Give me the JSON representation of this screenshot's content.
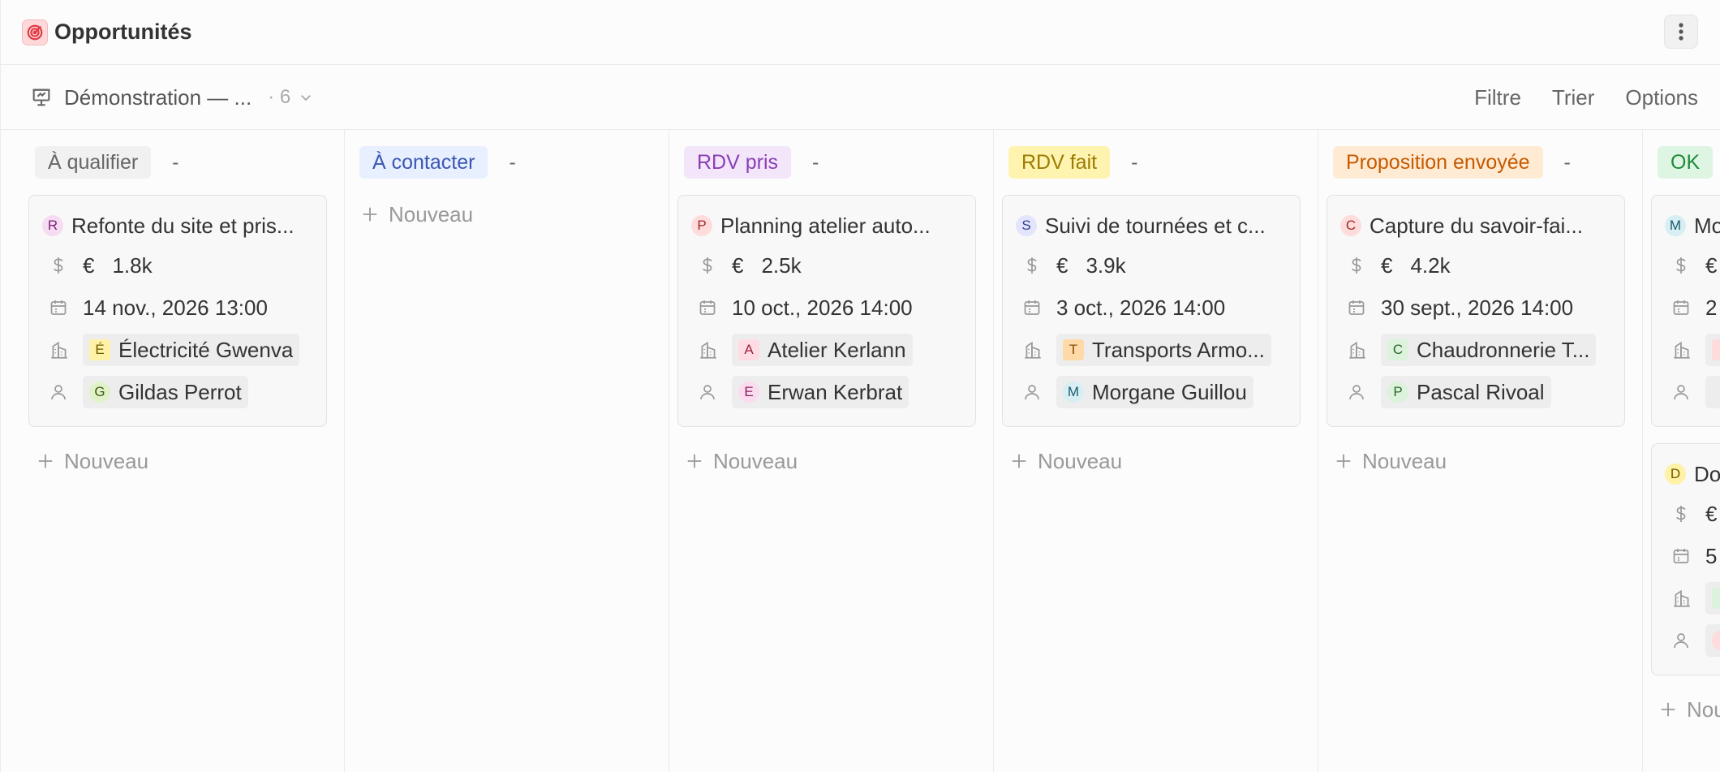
{
  "header": {
    "title": "Opportunités"
  },
  "view": {
    "name": "Démonstration — ...",
    "count": "· 6",
    "actions": {
      "filter": "Filtre",
      "sort": "Trier",
      "options": "Options"
    }
  },
  "new_label": "Nouveau",
  "columns": [
    {
      "label": "À qualifier",
      "dash": "-",
      "bg": "#f1f1f1",
      "fg": "#666666",
      "cards": [
        {
          "initial": "R",
          "avatar_bg": "#f6dcf3",
          "avatar_fg": "#7a1f72",
          "title": "Refonte du site et pris...",
          "currency": "€",
          "amount": "1.8k",
          "date": "14 nov., 2026 13:00",
          "company_initial": "É",
          "company_bg": "#fff1a6",
          "company_fg": "#6b5a00",
          "company": "Électricité Gwenva",
          "person_initial": "G",
          "person_bg": "#e1f2c8",
          "person_fg": "#3d5a14",
          "person": "Gildas Perrot"
        }
      ]
    },
    {
      "label": "À contacter",
      "dash": "-",
      "bg": "#e8efff",
      "fg": "#3c57b3",
      "cards": []
    },
    {
      "label": "RDV pris",
      "dash": "-",
      "bg": "#f3e6fb",
      "fg": "#8a3fb5",
      "cards": [
        {
          "initial": "P",
          "avatar_bg": "#ffdcdc",
          "avatar_fg": "#a22a2a",
          "title": "Planning atelier auto...",
          "currency": "€",
          "amount": "2.5k",
          "date": "10 oct., 2026 14:00",
          "company_initial": "A",
          "company_bg": "#ffdce3",
          "company_fg": "#9c2342",
          "company": "Atelier Kerlann",
          "person_initial": "E",
          "person_bg": "#fbdcef",
          "person_fg": "#8b1d63",
          "person": "Erwan Kerbrat"
        }
      ]
    },
    {
      "label": "RDV fait",
      "dash": "-",
      "bg": "#fff3b0",
      "fg": "#9a7d00",
      "cards": [
        {
          "initial": "S",
          "avatar_bg": "#e2e5fb",
          "avatar_fg": "#33408f",
          "title": "Suivi de tournées et c...",
          "currency": "€",
          "amount": "3.9k",
          "date": "3 oct., 2026 14:00",
          "company_initial": "T",
          "company_bg": "#ffd9a8",
          "company_fg": "#8a4a00",
          "company": "Transports Armo...",
          "person_initial": "M",
          "person_bg": "#d7eef3",
          "person_fg": "#1d5a6a",
          "person": "Morgane Guillou"
        }
      ]
    },
    {
      "label": "Proposition envoyée",
      "dash": "-",
      "bg": "#ffebd3",
      "fg": "#c75a00",
      "cards": [
        {
          "initial": "C",
          "avatar_bg": "#ffdcdc",
          "avatar_fg": "#a22a2a",
          "title": "Capture du savoir-fai...",
          "currency": "€",
          "amount": "4.2k",
          "date": "30 sept., 2026 14:00",
          "company_initial": "C",
          "company_bg": "#dcf2dc",
          "company_fg": "#2a6a2a",
          "company": "Chaudronnerie T...",
          "person_initial": "P",
          "person_bg": "#dcf2dc",
          "person_fg": "#2a6a2a",
          "person": "Pascal Rivoal"
        }
      ]
    },
    {
      "label": "OK",
      "dash": "",
      "bg": "#def5e3",
      "fg": "#1f8a3a",
      "cards": [
        {
          "initial": "M",
          "avatar_bg": "#d7eef3",
          "avatar_fg": "#1d5a6a",
          "title": "Mo",
          "currency": "€",
          "amount": "",
          "date": "2",
          "company_initial": "",
          "company_bg": "#ffdcdc",
          "company_fg": "#a22a2a",
          "company": "",
          "person_initial": "",
          "person_bg": "#ededed",
          "person_fg": "#555555",
          "person": ""
        },
        {
          "initial": "D",
          "avatar_bg": "#fff1a6",
          "avatar_fg": "#6b5a00",
          "title": "Do",
          "currency": "€",
          "amount": "",
          "date": "5",
          "company_initial": "",
          "company_bg": "#dcf2dc",
          "company_fg": "#2a6a2a",
          "company": "",
          "person_initial": "",
          "person_bg": "#ffdcdc",
          "person_fg": "#a22a2a",
          "person": ""
        }
      ]
    }
  ]
}
